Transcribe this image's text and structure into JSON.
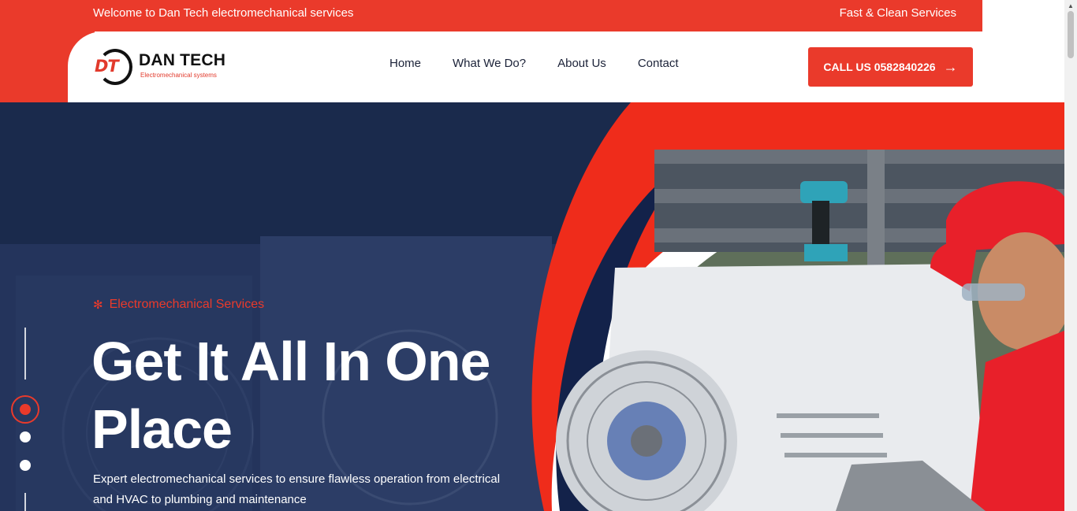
{
  "topbar": {
    "welcome": "Welcome to Dan Tech electromechanical services",
    "tagline": "Fast & Clean Services"
  },
  "logo": {
    "mark": "DT",
    "name": "DAN TECH",
    "tag": "Electromechanical systems"
  },
  "nav": {
    "items": [
      "Home",
      "What We Do?",
      "About Us",
      "Contact"
    ]
  },
  "cta": {
    "label": "CALL US 0582840226",
    "icon": "arrow-right-icon"
  },
  "hero": {
    "eyebrow": "Electromechanical Services",
    "eyebrow_icon": "fan-icon",
    "headline_line1": "Get It All In One",
    "headline_line2": "Place",
    "subtext": "Expert electromechanical services to ensure flawless operation from electrical and HVAC to plumbing and maintenance",
    "slider_dots": 3,
    "active_slide": 1
  },
  "colors": {
    "accent": "#ea3a2b",
    "navy": "#1b2238",
    "hero_overlay": "#1f2d52"
  }
}
